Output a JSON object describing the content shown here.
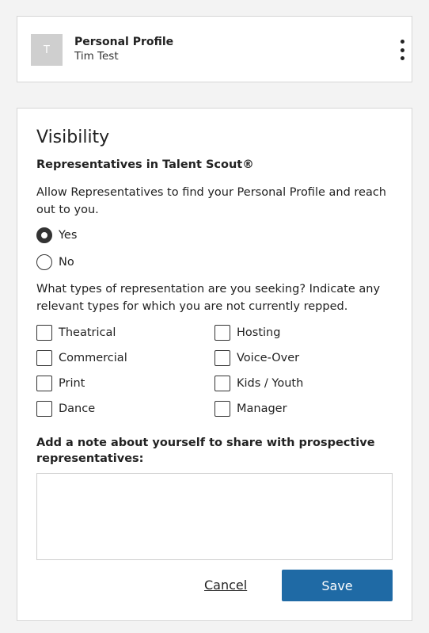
{
  "profile": {
    "avatar_initial": "T",
    "title": "Personal Profile",
    "name": "Tim Test",
    "menu_icon": "kebab-icon"
  },
  "visibility": {
    "title": "Visibility",
    "rep_heading": "Representatives in Talent Scout®",
    "rep_description": "Allow Representatives to find your Personal Profile and reach out to you.",
    "radio_options": [
      {
        "label": "Yes",
        "checked": true
      },
      {
        "label": "No",
        "checked": false
      }
    ],
    "seeking_question": "What types of representation are you seeking? Indicate any relevant types for which you are not currently repped.",
    "rep_types": [
      {
        "label": "Theatrical",
        "checked": false
      },
      {
        "label": "Hosting",
        "checked": false
      },
      {
        "label": "Commercial",
        "checked": false
      },
      {
        "label": "Voice-Over",
        "checked": false
      },
      {
        "label": "Print",
        "checked": false
      },
      {
        "label": "Kids / Youth",
        "checked": false
      },
      {
        "label": "Dance",
        "checked": false
      },
      {
        "label": "Manager",
        "checked": false
      }
    ],
    "note_label": "Add a note about yourself to share with prospective representatives:",
    "note_value": "",
    "cancel_label": "Cancel",
    "save_label": "Save",
    "accent_color": "#1f6aa5"
  }
}
